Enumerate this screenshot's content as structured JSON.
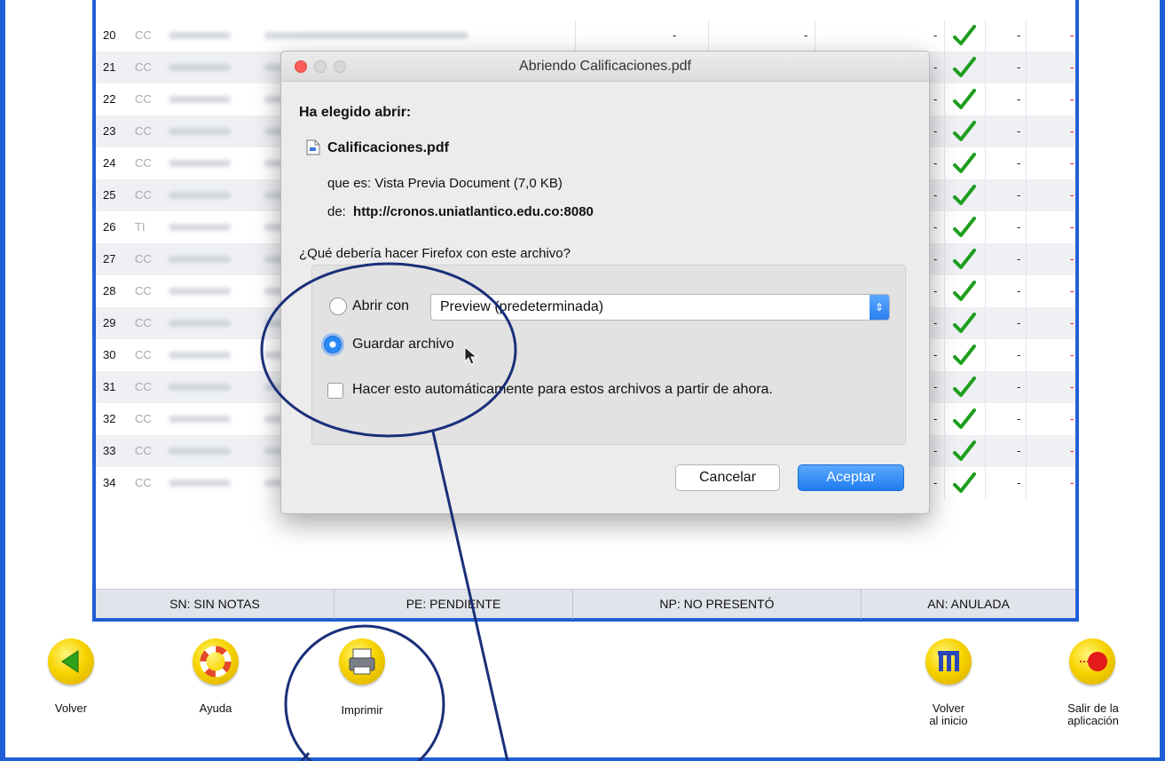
{
  "table": {
    "rows": [
      {
        "num": "20",
        "doc": "CC"
      },
      {
        "num": "21",
        "doc": "CC"
      },
      {
        "num": "22",
        "doc": "CC"
      },
      {
        "num": "23",
        "doc": "CC"
      },
      {
        "num": "24",
        "doc": "CC"
      },
      {
        "num": "25",
        "doc": "CC"
      },
      {
        "num": "26",
        "doc": "TI"
      },
      {
        "num": "27",
        "doc": "CC"
      },
      {
        "num": "28",
        "doc": "CC"
      },
      {
        "num": "29",
        "doc": "CC"
      },
      {
        "num": "30",
        "doc": "CC"
      },
      {
        "num": "31",
        "doc": "CC"
      },
      {
        "num": "32",
        "doc": "CC"
      },
      {
        "num": "33",
        "doc": "CC"
      },
      {
        "num": "34",
        "doc": "CC"
      }
    ],
    "dash": "-",
    "status_color_ok": "#1e9e1e",
    "status_color_missing": "#dd0000"
  },
  "legend": {
    "sn": "SN: SIN NOTAS",
    "pe": "PE: PENDIENTE",
    "np": "NP: NO PRESENTÓ",
    "an": "AN: ANULADA"
  },
  "buttons": {
    "volver": "Volver",
    "ayuda": "Ayuda",
    "imprimir": "Imprimir",
    "inicio_1": "Volver",
    "inicio_2": "al inicio",
    "salir_1": "Salir de la",
    "salir_2": "aplicación"
  },
  "dialog": {
    "title": "Abriendo Calificaciones.pdf",
    "heading": "Ha elegido abrir:",
    "filename": "Calificaciones.pdf",
    "type_line": "que es: Vista Previa Document (7,0 KB)",
    "from_label": "de:",
    "from_url": "http://cronos.uniatlantico.edu.co:8080",
    "question": "¿Qué debería hacer Firefox con este archivo?",
    "open_with_label": "Abrir con",
    "open_with_value": "Preview (predeterminada)",
    "save_label": "Guardar archivo",
    "auto_label": "Hacer esto automáticamente para estos archivos a partir de ahora.",
    "cancel": "Cancelar",
    "accept": "Aceptar",
    "selected_option": "Guardar archivo"
  },
  "icons": {
    "volver": "green-left-arrow-icon",
    "ayuda": "lifebuoy-icon",
    "imprimir": "printer-icon",
    "inicio": "home-building-icon",
    "salir": "exit-icon",
    "pdf": "pdf-file-icon"
  },
  "colors": {
    "frame_blue": "#1f5fd6",
    "accent_blue": "#2b8af7",
    "annotation_blue": "#1a2f7a"
  }
}
